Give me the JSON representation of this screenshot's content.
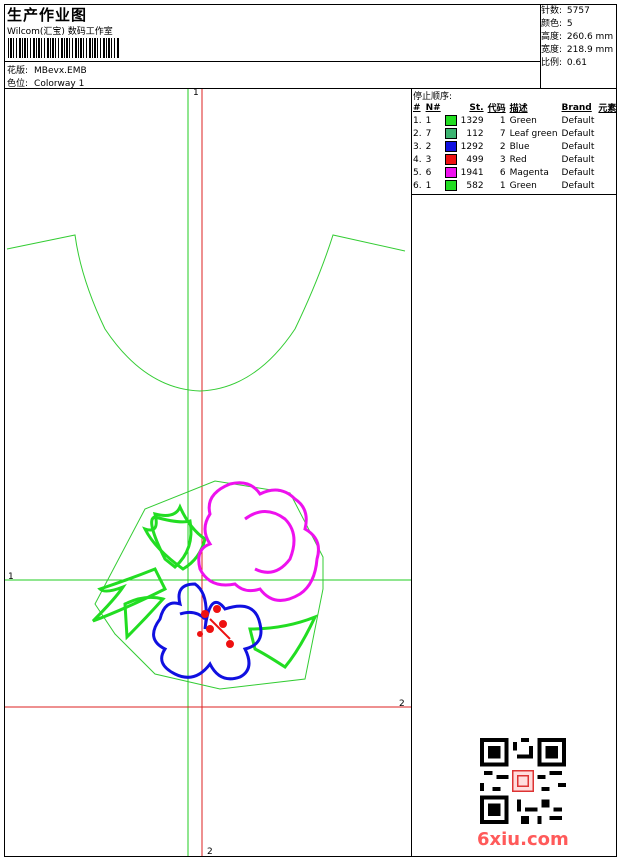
{
  "header": {
    "title": "生产作业图",
    "company": "Wilcom(汇宝) 数码工作室",
    "design_label": "花版:",
    "design_value": "MBevx.EMB",
    "colorway_label": "色位:",
    "colorway_value": "Colorway 1"
  },
  "stats": {
    "stitches_label": "针数:",
    "stitches_value": "5757",
    "colors_label": "颜色:",
    "colors_value": "5",
    "height_label": "高度:",
    "height_value": "260.6 mm",
    "width_label": "宽度:",
    "width_value": "218.9 mm",
    "scale_label": "比例:",
    "scale_value": "0.61"
  },
  "sequence": {
    "title": "停止顺序:",
    "headers": [
      "#",
      "N#",
      "",
      "St.",
      "代码",
      "描述",
      "Brand",
      "元素"
    ],
    "rows": [
      {
        "idx": "1.",
        "n": "1",
        "color": "#22dd22",
        "st": "1329",
        "code": "1",
        "desc": "Green",
        "brand": "Default"
      },
      {
        "idx": "2.",
        "n": "7",
        "color": "#3cb371",
        "st": "112",
        "code": "7",
        "desc": "Leaf green",
        "brand": "Default"
      },
      {
        "idx": "3.",
        "n": "2",
        "color": "#1010e0",
        "st": "1292",
        "code": "2",
        "desc": "Blue",
        "brand": "Default"
      },
      {
        "idx": "4.",
        "n": "3",
        "color": "#ee1111",
        "st": "499",
        "code": "3",
        "desc": "Red",
        "brand": "Default"
      },
      {
        "idx": "5.",
        "n": "6",
        "color": "#ee11ee",
        "st": "1941",
        "code": "6",
        "desc": "Magenta",
        "brand": "Default"
      },
      {
        "idx": "6.",
        "n": "1",
        "color": "#22dd22",
        "st": "582",
        "code": "1",
        "desc": "Green",
        "brand": "Default"
      }
    ]
  },
  "axes": {
    "top_green_label": "1",
    "left_green_label": "1",
    "right_red_label": "2",
    "bottom_red_label": "2"
  },
  "watermark": "6xiu.com",
  "colors": {
    "guide_green": "#22cc22",
    "guide_red": "#dd2222",
    "neckline": "#33cc33"
  }
}
